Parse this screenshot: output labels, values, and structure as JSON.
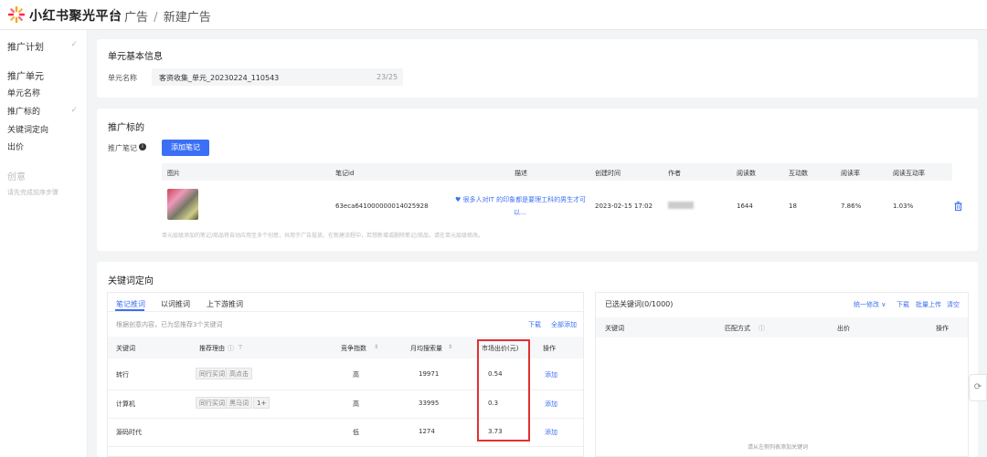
{
  "header": {
    "brand": "小红书聚光平台",
    "breadcrumb_ad": "广告",
    "breadcrumb_sep": "/",
    "breadcrumb_new": "新建广告"
  },
  "sidebar": {
    "plan": "推广计划",
    "unit": "推广单元",
    "unit_name": "单元名称",
    "target": "推广标的",
    "keywords": "关键词定向",
    "bid": "出价",
    "creative": "创意",
    "creative_hint": "请先完成前序步骤",
    "check": "✓"
  },
  "unit_info": {
    "title": "单元基本信息",
    "name_label": "单元名称",
    "name_value": "客资收集_单元_20230224_110543",
    "name_count": "23/25"
  },
  "target": {
    "title": "推广标的",
    "note_label": "推广笔记",
    "add_button": "添加笔记",
    "columns": [
      "图片",
      "笔记id",
      "描述",
      "创建时间",
      "作者",
      "阅读数",
      "互动数",
      "阅读率",
      "阅读互动率"
    ],
    "row": {
      "note_id": "63eca641000000014025928",
      "desc_line1": "♥ 很多人对IT 的印象都是要理工科的男生才可",
      "desc_line2": "以...",
      "created": "2023-02-15 17:02",
      "reads": "1644",
      "interactions": "18",
      "read_rate": "7.86%",
      "interact_rate": "1.03%"
    },
    "footnote": "单元层级添加的笔记/商品将自动应用至多个创意，共用于广告投放。在新建流程中，若想新增或删除笔记/商品，请在单元层级修改。"
  },
  "keyword": {
    "title": "关键词定向",
    "tabs": [
      "笔记推词",
      "以词推词",
      "上下游推词"
    ],
    "hint": "根据创意内容，已为您推荐3个关键词",
    "download": "下载",
    "add_all": "全部添加",
    "columns": [
      "关键词",
      "推荐理由",
      "竞争指数",
      "月均搜索量",
      "市场出价(元)",
      "操作"
    ],
    "rows": [
      {
        "keyword": "转行",
        "tags": [
          "同行买词",
          "高点击"
        ],
        "more": "",
        "competition": "高",
        "search": "19971",
        "price": "0.54",
        "action": "添加"
      },
      {
        "keyword": "计算机",
        "tags": [
          "同行买词",
          "黑马词"
        ],
        "more": "1+",
        "competition": "高",
        "search": "33995",
        "price": "0.3",
        "action": "添加"
      },
      {
        "keyword": "源码时代",
        "tags": [],
        "more": "",
        "competition": "低",
        "search": "1274",
        "price": "3.73",
        "action": "添加"
      }
    ],
    "selected": {
      "title": "已选关键词(0/1000)",
      "bulk_edit": "统一修改 ∨",
      "download": "下载",
      "bulk_upload": "批量上传",
      "clear": "清空",
      "columns": [
        "关键词",
        "匹配方式",
        "出价",
        "操作"
      ],
      "empty": "请从左侧列表添加关键词"
    }
  }
}
